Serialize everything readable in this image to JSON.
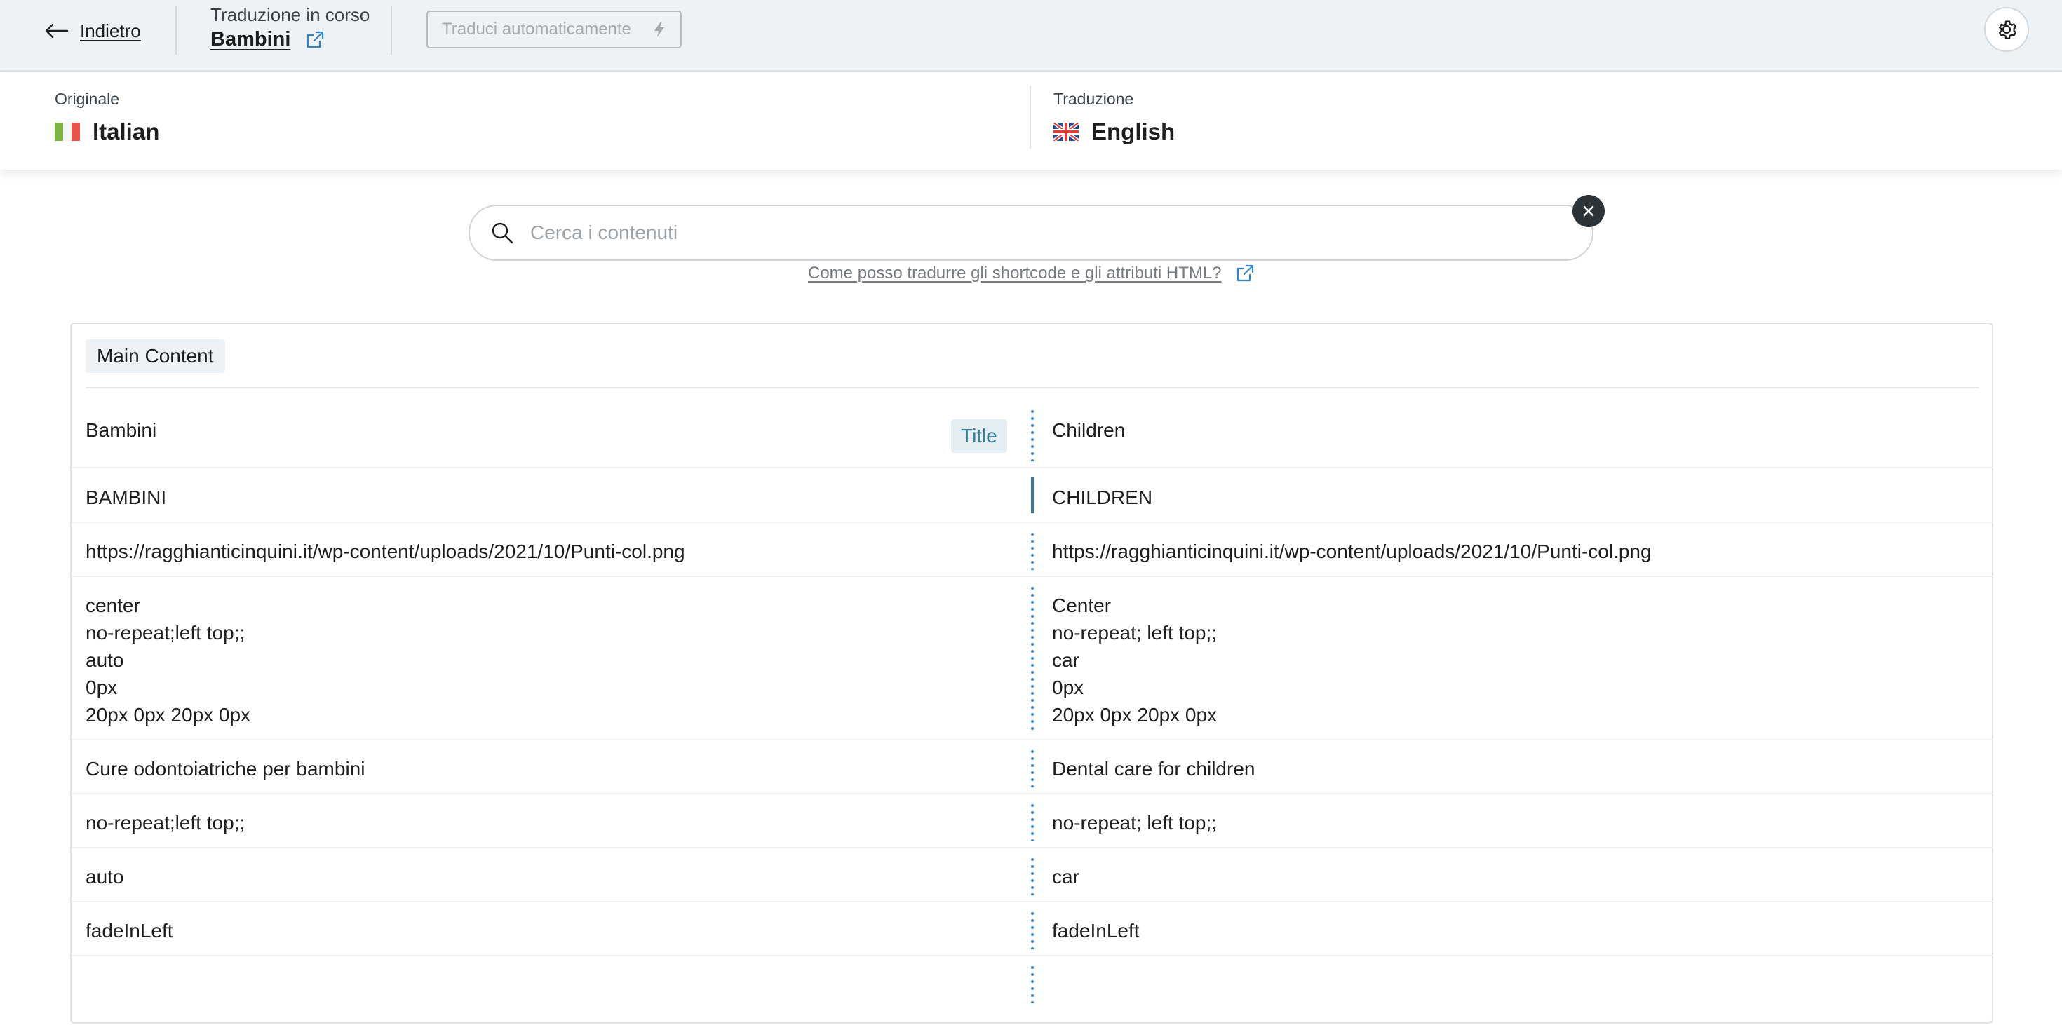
{
  "topbar": {
    "back_label": "Indietro",
    "status_label": "Traduzione in corso",
    "post_title": "Bambini",
    "auto_translate_label": "Traduci automaticamente",
    "icons": {
      "back": "arrow-left-icon",
      "external": "external-link-icon",
      "bolt": "lightning-icon",
      "settings": "gear-icon"
    }
  },
  "languages": {
    "original_caption": "Originale",
    "original_name": "Italian",
    "translation_caption": "Traduzione",
    "translation_name": "English"
  },
  "search": {
    "placeholder": "Cerca i contenuti",
    "value": "",
    "help_link": "Come posso tradurre gli shortcode e gli attributi HTML?"
  },
  "section": {
    "label": "Main Content",
    "rows": [
      {
        "source": "Bambini",
        "translation": "Children",
        "badge": "Title",
        "bar": "dotted"
      },
      {
        "source": "BAMBINI",
        "translation": "CHILDREN",
        "bar": "solid"
      },
      {
        "source": "https://ragghianticinquini.it/wp-content/uploads/2021/10/Punti-col.png",
        "translation": "https://ragghianticinquini.it/wp-content/uploads/2021/10/Punti-col.png",
        "bar": "dotted"
      },
      {
        "source": "center\nno-repeat;left top;;\nauto\n0px\n20px 0px 20px 0px",
        "translation": "Center\nno-repeat; left top;;\ncar\n0px\n20px 0px 20px 0px",
        "bar": "dotted"
      },
      {
        "source": "Cure odontoiatriche per bambini",
        "translation": "Dental care for children",
        "bar": "dotted"
      },
      {
        "source": "no-repeat;left top;;",
        "translation": "no-repeat; left top;;",
        "bar": "dotted"
      },
      {
        "source": "auto",
        "translation": "car",
        "bar": "dotted"
      },
      {
        "source": "fadeInLeft",
        "translation": "fadeInLeft",
        "bar": "dotted"
      }
    ]
  },
  "colors": {
    "topbar_bg": "#eef2f5",
    "accent": "#3582c4",
    "active_bar": "#3a7c93",
    "badge_text": "#3a7c93"
  }
}
